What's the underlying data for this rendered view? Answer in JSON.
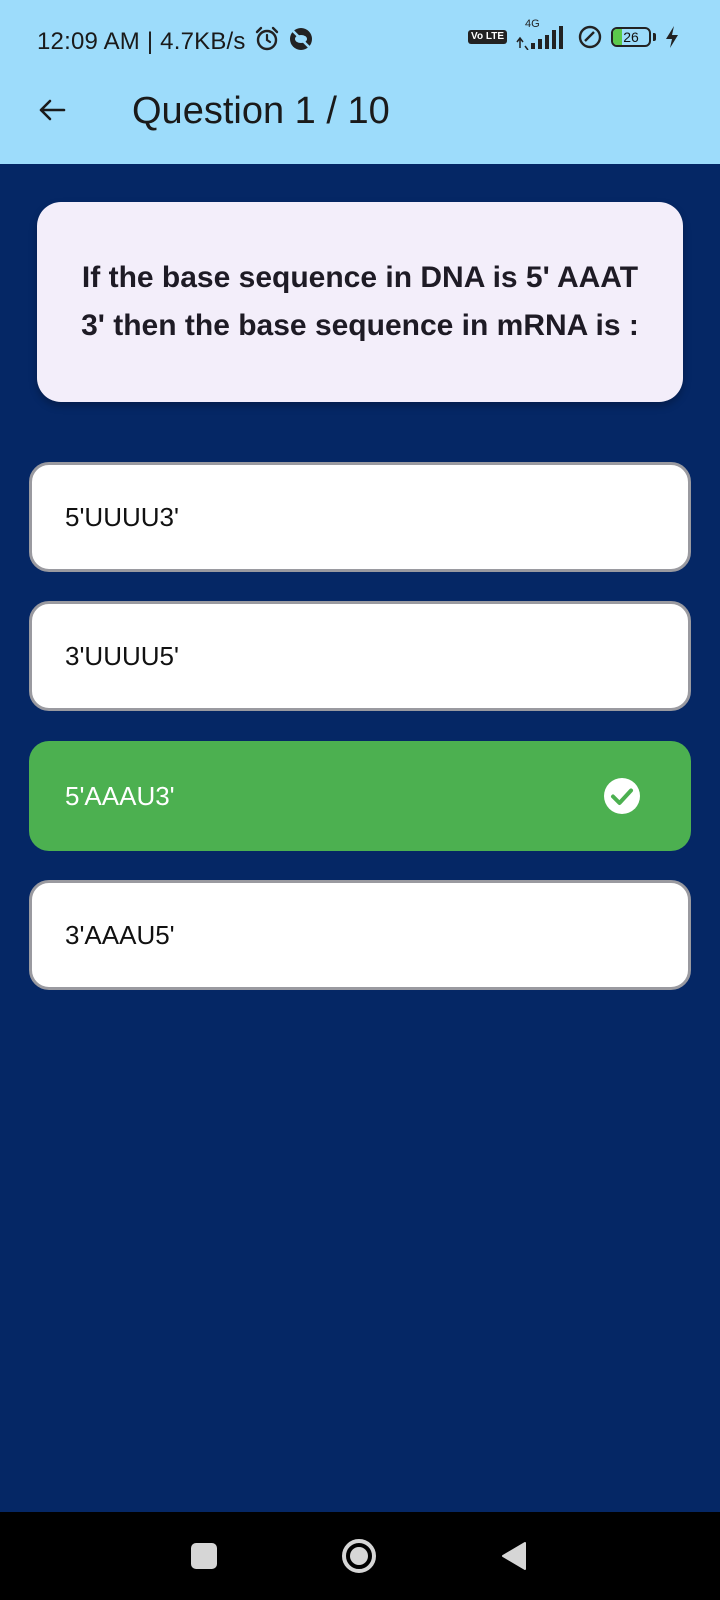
{
  "status_bar": {
    "time_speed": "12:09 AM | 4.7KB/s",
    "volte": "Vo LTE",
    "network": "4G",
    "battery_level": "26",
    "battery_percent": 26
  },
  "header": {
    "title": "Question 1 / 10"
  },
  "question": {
    "text": "If the base sequence in DNA is 5' AAAT 3' then the base sequence in mRNA is :"
  },
  "options": [
    {
      "label": "5'UUUU3'",
      "state": "default"
    },
    {
      "label": "3'UUUU5'",
      "state": "default"
    },
    {
      "label": "5'AAAU3'",
      "state": "correct"
    },
    {
      "label": "3'AAAU5'",
      "state": "default"
    }
  ],
  "colors": {
    "top_bar": "#9ddcfb",
    "background": "#052765",
    "correct": "#4cb050",
    "card": "#f3eefa"
  },
  "icons": {
    "back": "arrow-left-icon",
    "correct_mark": "check-circle-icon",
    "nav_recents": "square-icon",
    "nav_home": "circle-icon",
    "nav_back": "triangle-back-icon"
  }
}
